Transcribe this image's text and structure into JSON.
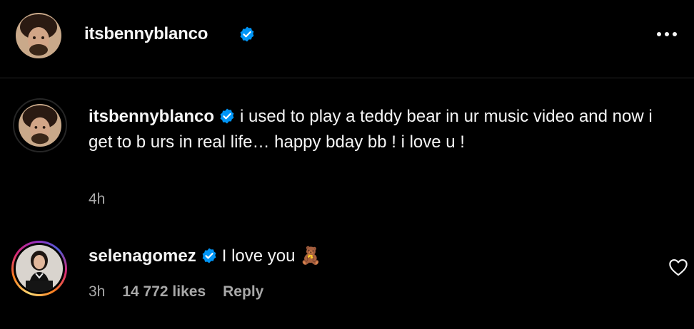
{
  "header": {
    "username": "itsbennyblanco",
    "verified_icon": "verified-badge-icon",
    "more_icon": "more-options-icon"
  },
  "comments": [
    {
      "username": "itsbennyblanco",
      "text": "i used to play a teddy bear in ur music video and now i get to b urs in real life… happy bday bb ! i love u !",
      "time": "4h",
      "verified": true
    },
    {
      "username": "selenagomez",
      "text": "I love you 🧸",
      "time": "3h",
      "likes": "14 772 likes",
      "reply_label": "Reply",
      "verified": true,
      "like_icon": "heart-outline-icon"
    }
  ],
  "colors": {
    "background": "#000000",
    "text": "#f5f5f5",
    "secondary_text": "#a8a8a8",
    "verified_blue": "#0095f6",
    "divider": "#262626"
  }
}
